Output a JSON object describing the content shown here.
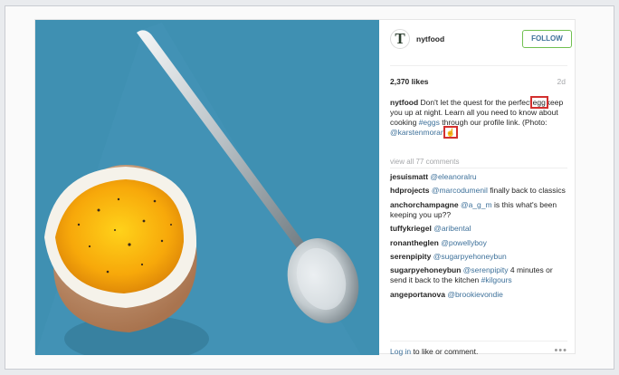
{
  "header": {
    "avatar_glyph": "T",
    "username": "nytfood",
    "follow_label": "FOLLOW"
  },
  "stats": {
    "likes": "2,370 likes",
    "age": "2d"
  },
  "caption": {
    "author": "nytfood",
    "text_1": "Don't let the quest for the perfect",
    "highlight_word": "egg",
    "text_2": "keep you up at night. Learn all you need to know about cooking",
    "hashtag": "#eggs",
    "text_3": "through our profile link. (Photo:",
    "mention": "@karstenmoran",
    "cursor_glyph": "☝"
  },
  "comments": {
    "view_all": "view all 77 comments",
    "items": [
      {
        "user": "jesuismatt",
        "text": "@eleanoralru"
      },
      {
        "user": "hdprojects",
        "mention": "@marcodumenil",
        "text": "finally back to classics"
      },
      {
        "user": "anchorchampagne",
        "mention": "@a_g_m",
        "text": "is this what's been keeping you up??"
      },
      {
        "user": "tuffykriegel",
        "text": "@aribental"
      },
      {
        "user": "ronantheglen",
        "text": "@powellyboy"
      },
      {
        "user": "serenpipity",
        "text": "@sugarpyehoneybun"
      },
      {
        "user": "sugarpyehoneybun",
        "mention": "@serenpipity",
        "text": "4 minutes or send it back to the kitchen",
        "hashtag": "#kilgours"
      },
      {
        "user": "angeportanova",
        "text": "@brookievondie"
      }
    ]
  },
  "footer": {
    "login": "Log in",
    "rest": "to like or comment.",
    "more": "•••"
  },
  "colors": {
    "link": "#3f729b",
    "highlight_box": "#d3302f",
    "follow_border": "#70c050",
    "photo_background": "#3f90b2"
  }
}
